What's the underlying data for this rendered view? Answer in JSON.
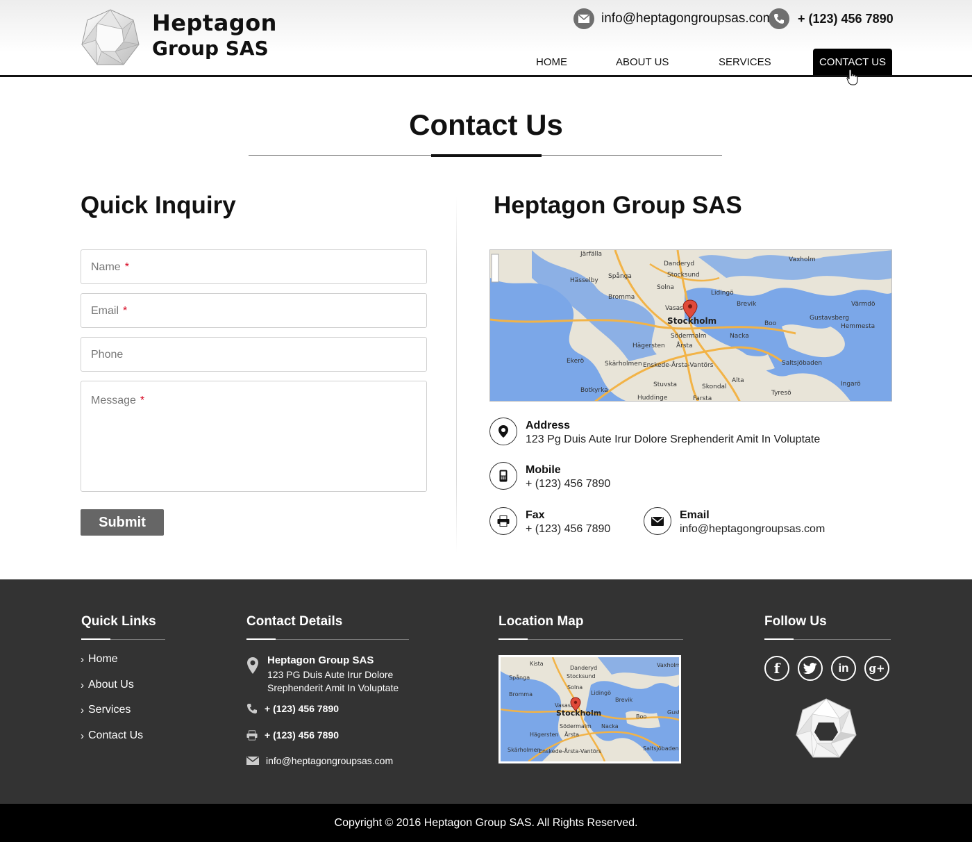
{
  "header": {
    "logo_line1": "Heptagon",
    "logo_line2": "Group SAS",
    "email": "info@heptagongroupsas.com",
    "phone": "+ (123) 456 7890"
  },
  "nav": {
    "items": [
      {
        "label": "HOME"
      },
      {
        "label": "ABOUT US"
      },
      {
        "label": "SERVICES"
      },
      {
        "label": "CONTACT US",
        "active": true
      }
    ]
  },
  "page": {
    "title": "Contact Us"
  },
  "form": {
    "heading": "Quick Inquiry",
    "name_placeholder": "Name",
    "email_placeholder": "Email",
    "phone_placeholder": "Phone",
    "message_placeholder": "Message",
    "required_mark": "*",
    "submit_label": "Submit"
  },
  "company": {
    "heading": "Heptagon Group SAS",
    "address_label": "Address",
    "address_value": "123 Pg Duis Aute Irur Dolore Srephenderit Amit In Voluptate",
    "mobile_label": "Mobile",
    "mobile_value": "+ (123) 456 7890",
    "fax_label": "Fax",
    "fax_value": "+ (123) 456 7890",
    "email_label": "Email",
    "email_value": "info@heptagongroupsas.com"
  },
  "map": {
    "labels": [
      "Järfälla",
      "Danderyd",
      "Vaxholm",
      "Hässelby",
      "Spånga",
      "Stocksund",
      "Solna",
      "Lidingö",
      "Bromma",
      "Brevik",
      "Värmdö",
      "Vasastan",
      "Stockholm",
      "Gustavsberg",
      "Hemmesta",
      "Boo",
      "Södermalm",
      "Nacka",
      "Hägersten",
      "Årsta",
      "Ekerö",
      "Skärholmen",
      "Enskede-Årsta-Vantörs",
      "Saltsjöbaden",
      "Stuvsta",
      "Skondal",
      "Alta",
      "Botkyrka",
      "Huddinge",
      "Farsta",
      "Tyresö",
      "Ingarö"
    ],
    "small_labels": [
      "Kista",
      "Danderyd",
      "Vaxholm",
      "Spånga",
      "Stocksund",
      "Solna",
      "Bromma",
      "Lidingö",
      "Brevik",
      "Vasastan",
      "Stockholm",
      "Boo",
      "Gust",
      "Södermalm",
      "Nacka",
      "Hägersten",
      "Årsta",
      "Skärholmen",
      "Enskede-Årsta-Vantörs",
      "Saltsjöbaden"
    ],
    "water_color": "#7ba7e8",
    "land_color": "#e8e4d8",
    "road_color": "#f2b347",
    "pin_color": "#e04a3a"
  },
  "footer": {
    "quick_links_heading": "Quick Links",
    "links": [
      {
        "label": "Home"
      },
      {
        "label": "About Us"
      },
      {
        "label": "Services"
      },
      {
        "label": "Contact Us"
      }
    ],
    "contact_heading": "Contact Details",
    "contact_name": "Heptagon Group SAS",
    "contact_addr": "123 PG Duis Aute Irur Dolore Srephenderit Amit In Voluptate",
    "contact_phone": "+ (123) 456 7890",
    "contact_fax": "+ (123) 456 7890",
    "contact_email": "info@heptagongroupsas.com",
    "map_heading": "Location Map",
    "follow_heading": "Follow Us",
    "social": [
      {
        "name": "facebook-icon",
        "glyph": "f"
      },
      {
        "name": "twitter-icon",
        "glyph": "t"
      },
      {
        "name": "linkedin-icon",
        "glyph": "in"
      },
      {
        "name": "google-plus-icon",
        "glyph": "g+"
      }
    ],
    "bg_color": "#333333"
  },
  "copyright": "Copyright © 2016 Heptagon Group SAS.  All Rights Reserved."
}
